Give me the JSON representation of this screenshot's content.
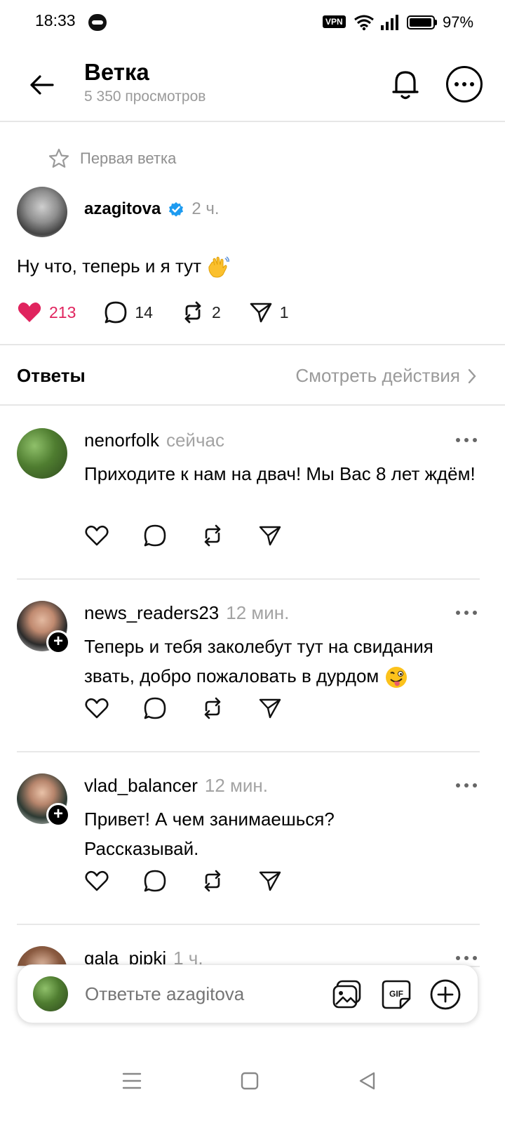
{
  "status_bar": {
    "time": "18:33",
    "vpn": "VPN",
    "battery": "97%"
  },
  "header": {
    "title": "Ветка",
    "views": "5 350 просмотров",
    "icons": [
      "back-arrow-icon",
      "bell-icon",
      "more-icon"
    ]
  },
  "post": {
    "pin_label": "Первая ветка",
    "author": "azagitova",
    "verified": true,
    "time": "2 ч.",
    "text": "Ну что, теперь и я тут",
    "emoji": "waving-hand",
    "likes": "213",
    "comments": "14",
    "reposts": "2",
    "shares": "1",
    "accent_like_color": "#e0245e",
    "verified_color": "#1d9bf0"
  },
  "replies_header": {
    "title": "Ответы",
    "view_activity": "Смотреть действия"
  },
  "replies": [
    {
      "author": "nenorfolk",
      "time": "сейчас",
      "text": "Приходите к нам на двач! Мы Вас 8 лет ждём!",
      "follow_badge": false
    },
    {
      "author": "news_readers23",
      "time": "12 мин.",
      "text": "Теперь и тебя заколебут тут на свидания звать, добро пожаловать в дурдом",
      "emoji": "winking-face-with-tongue",
      "follow_badge": true
    },
    {
      "author": "vlad_balancer",
      "time": "12 мин.",
      "text": "Привет! А чем занимаешься? Рассказывай.",
      "follow_badge": true
    },
    {
      "author": "gala_pipki",
      "time": "1 ч.",
      "text": "",
      "follow_badge": false
    }
  ],
  "composer": {
    "placeholder": "Ответьте azagitova",
    "gif_label": "GIF"
  }
}
